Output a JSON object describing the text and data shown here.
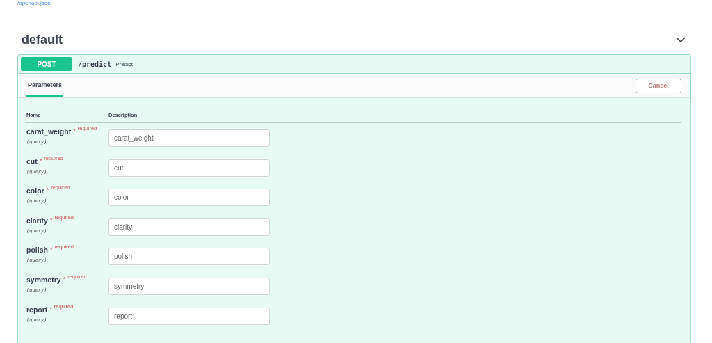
{
  "spec_link": "/openapi.json",
  "section": {
    "title": "default",
    "expanded": true
  },
  "operation": {
    "method": "POST",
    "path": "/predict",
    "summary": "Predict"
  },
  "tabs": [
    {
      "label": "Parameters",
      "selected": true
    }
  ],
  "cancel_button": "Cancel",
  "columns": [
    "Name",
    "Description"
  ],
  "parameters": [
    {
      "name": "carat_weight",
      "asterisk": "*",
      "required": "required",
      "location": "(query)",
      "placeholder": "carat_weight"
    },
    {
      "name": "cut",
      "asterisk": "*",
      "required": "required",
      "location": "(query)",
      "placeholder": "cut"
    },
    {
      "name": "color",
      "asterisk": "*",
      "required": "required",
      "location": "(query)",
      "placeholder": "color"
    },
    {
      "name": "clarity",
      "asterisk": "*",
      "required": "required",
      "location": "(query)",
      "placeholder": "clarity"
    },
    {
      "name": "polish",
      "asterisk": "*",
      "required": "required",
      "location": "(query)",
      "placeholder": "polish"
    },
    {
      "name": "symmetry",
      "asterisk": "*",
      "required": "required",
      "location": "(query)",
      "placeholder": "symmetry"
    },
    {
      "name": "report",
      "asterisk": "*",
      "required": "required",
      "location": "(query)",
      "placeholder": "report"
    }
  ]
}
